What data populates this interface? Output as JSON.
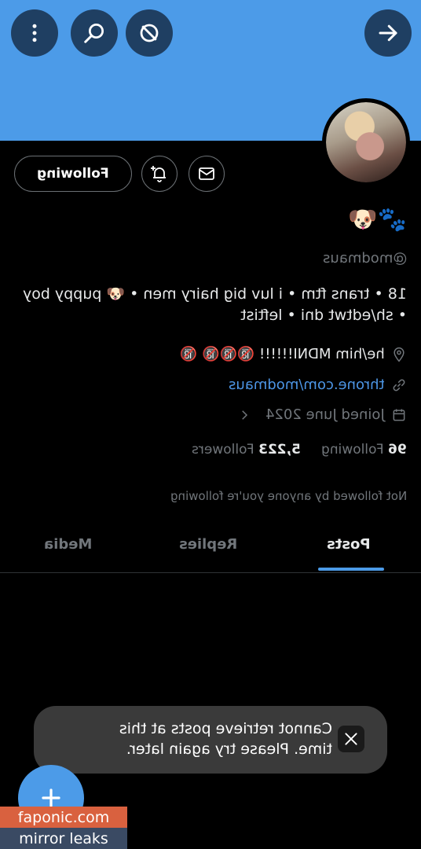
{
  "header": {
    "icons": [
      "more-vertical-icon",
      "search-icon",
      "no-sign-icon",
      "arrow-right-icon"
    ]
  },
  "actions": {
    "following_label": "Following",
    "icons": [
      "notification-add-icon",
      "mail-icon"
    ]
  },
  "profile": {
    "emoji": "🐶🐾",
    "handle": "@modmaus",
    "bio": "18 • trans ftm • i luv big hairy men • 🐶 puppy boy • sh/edtwt dni • leftist",
    "location": "he/him MDNI!!!!!! 🔞🔞🔞 🔞",
    "website": "throne.com/modmaus",
    "joined": "Joined June 2024",
    "following_count": "96",
    "following_label": "Following",
    "followers_count": "5,223",
    "followers_label": "Followers",
    "not_followed": "Not followed by anyone you're following"
  },
  "tabs": {
    "posts": "Posts",
    "replies": "Replies",
    "media": "Media",
    "active": "posts"
  },
  "toast": {
    "message": "Cannot retrieve posts at this time. Please try again later."
  },
  "fab": {
    "icon": "plus-icon"
  },
  "watermark": {
    "line1": "faponic.com",
    "line2": "mirror leaks"
  },
  "colors": {
    "banner": "#4c9be8",
    "accent": "#4c9be8",
    "link": "#4d96e6"
  }
}
